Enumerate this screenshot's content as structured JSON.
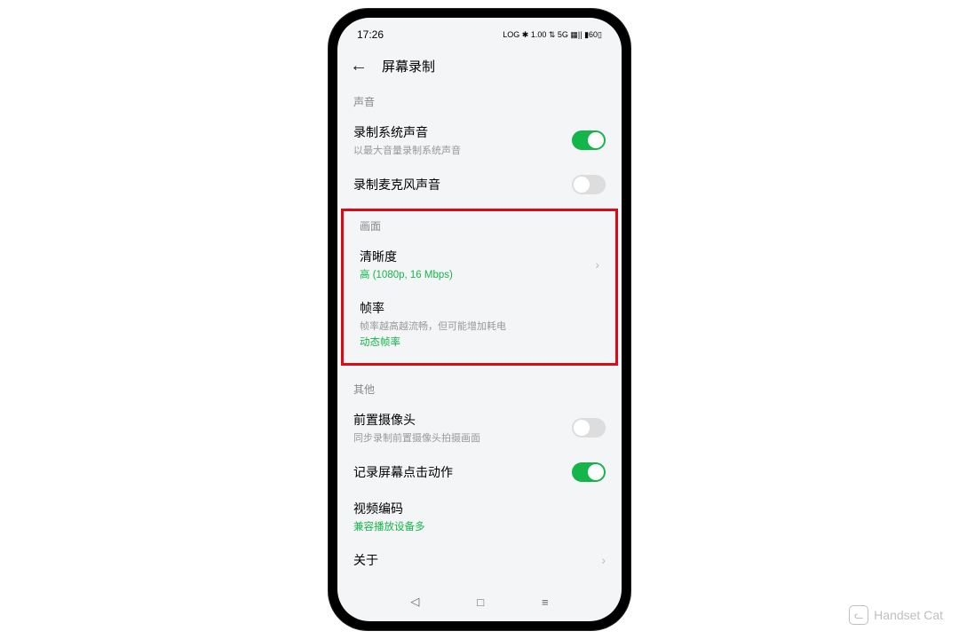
{
  "status_bar": {
    "time": "17:26",
    "indicators": "LOG ✱ 1.00 ⇅ 5G ▦|| ▮60▯"
  },
  "header": {
    "title": "屏幕录制"
  },
  "sections": {
    "sound": {
      "label": "声音",
      "record_system": {
        "title": "录制系统声音",
        "sub": "以最大音量录制系统声音",
        "on": true
      },
      "record_mic": {
        "title": "录制麦克风声音",
        "on": false
      }
    },
    "picture": {
      "label": "画面",
      "clarity": {
        "title": "清晰度",
        "value": "高 (1080p, 16 Mbps)"
      },
      "framerate": {
        "title": "帧率",
        "desc": "帧率越高越流畅，但可能增加耗电",
        "value": "动态帧率"
      }
    },
    "other": {
      "label": "其他",
      "front_cam": {
        "title": "前置摄像头",
        "sub": "同步录制前置摄像头拍摄画面",
        "on": false
      },
      "record_taps": {
        "title": "记录屏幕点击动作",
        "on": true
      },
      "encoding": {
        "title": "视频编码",
        "value": "兼容播放设备多"
      },
      "about": {
        "title": "关于"
      }
    }
  },
  "watermark": {
    "text": "Handset Cat",
    "icon": "ᓚ"
  }
}
